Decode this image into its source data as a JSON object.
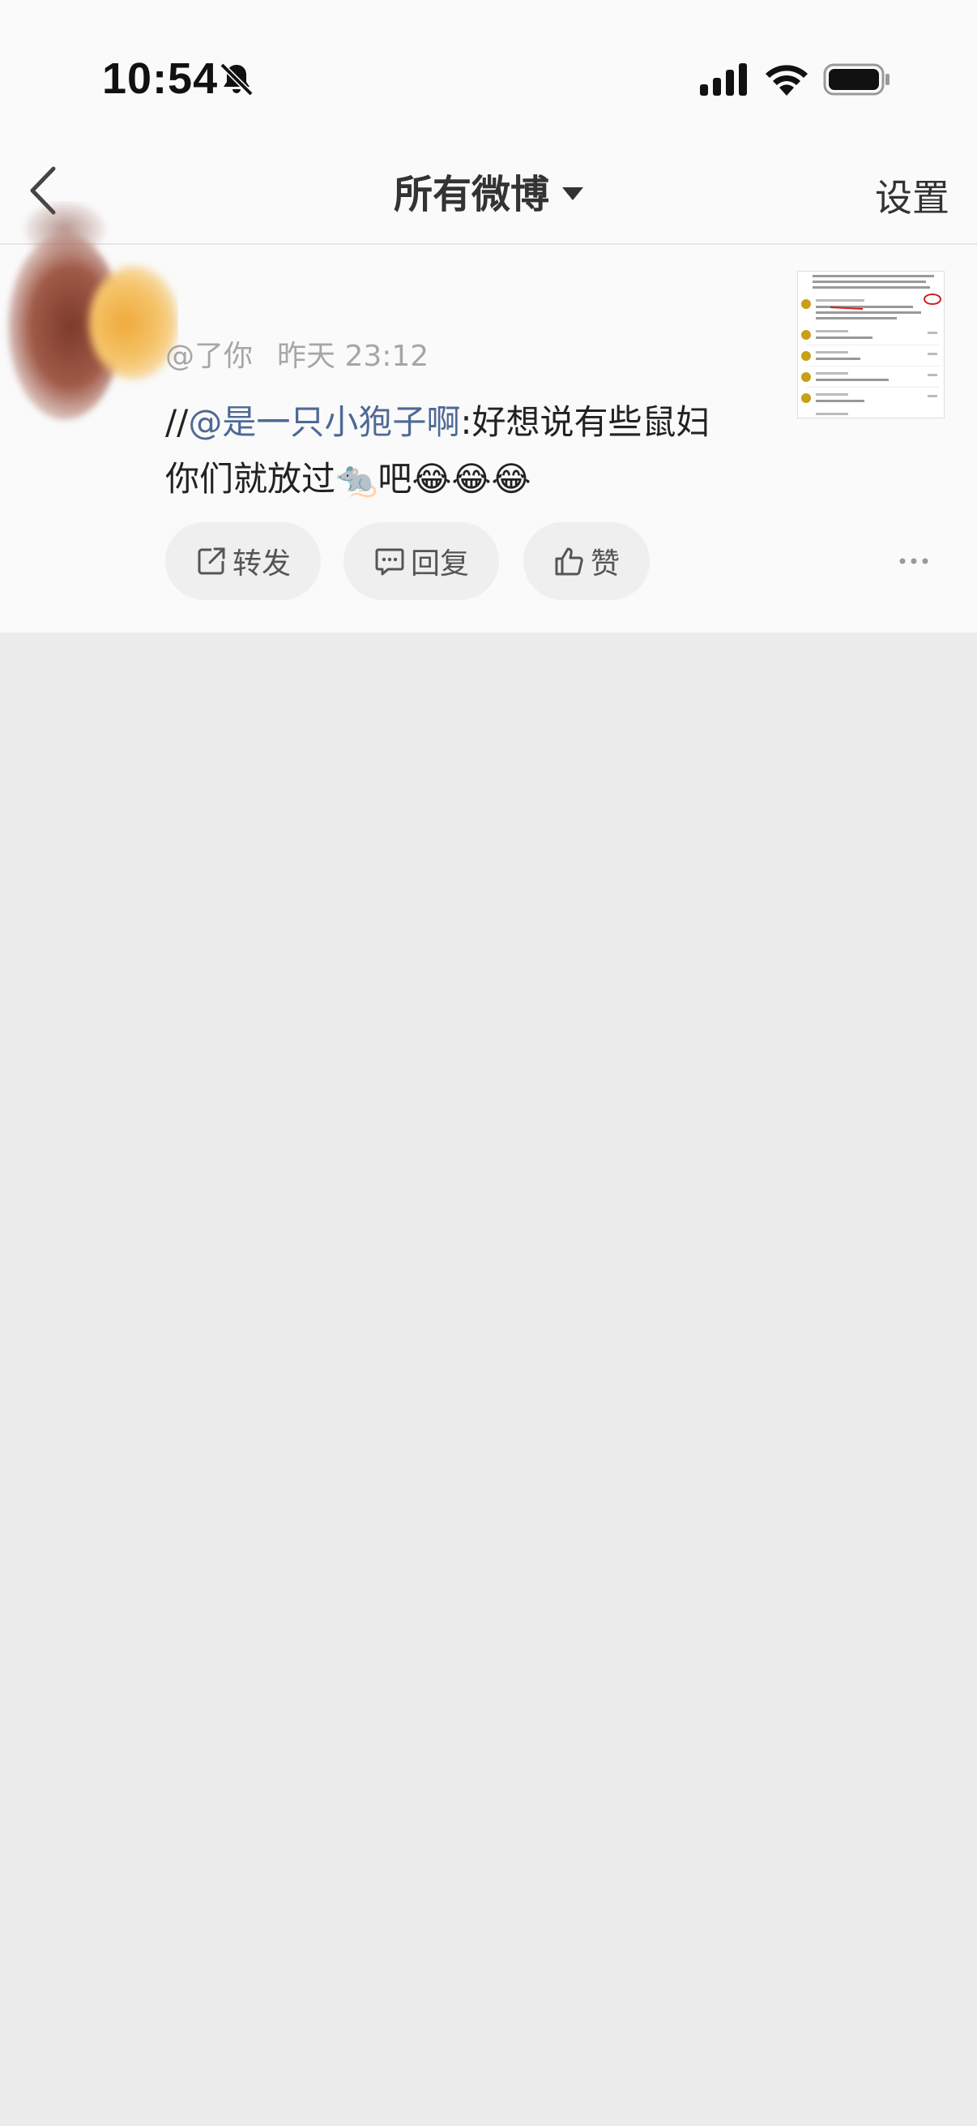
{
  "status_bar": {
    "time": "10:54",
    "icons": [
      "bell-slash-icon",
      "signal-icon",
      "wifi-icon",
      "battery-icon"
    ]
  },
  "nav": {
    "title": "所有微博",
    "settings_label": "设置"
  },
  "post": {
    "user_handle": "@了你",
    "date": "昨天 23:12",
    "text_prefix": "//",
    "mention": "@是一只小狍子啊",
    "text_after_mention": ":好想说有些鼠妇",
    "text_line2": "你们就放过",
    "rat_emoji": "🐀",
    "text_end": "吧",
    "laugh_emojis": "😂😂😂",
    "thumbnail_alt": "聊天截图"
  },
  "actions": {
    "repost_label": "转发",
    "reply_label": "回复",
    "like_label": "赞"
  },
  "colors": {
    "mention": "#4e6996",
    "background": "#ececec",
    "card": "#fafafa"
  }
}
